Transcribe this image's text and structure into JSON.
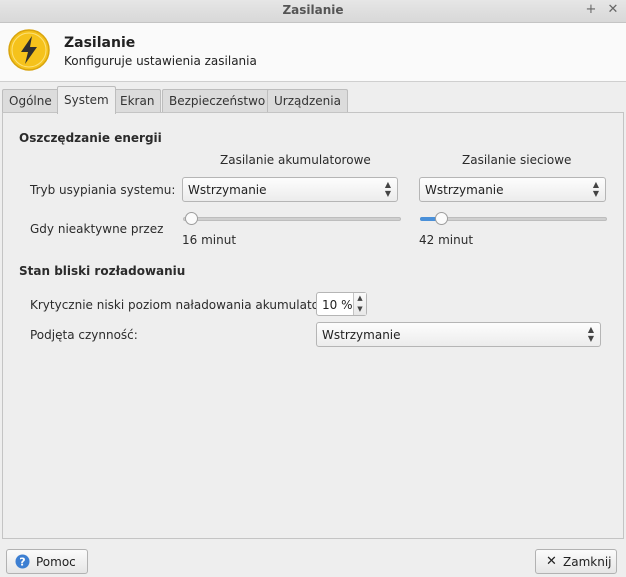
{
  "window": {
    "title": "Zasilanie"
  },
  "header": {
    "title": "Zasilanie",
    "subtitle": "Konfiguruje ustawienia zasilania"
  },
  "tabs": [
    {
      "label": "Ogólne"
    },
    {
      "label": "System"
    },
    {
      "label": "Ekran"
    },
    {
      "label": "Bezpieczeństwo"
    },
    {
      "label": "Urządzenia"
    }
  ],
  "energy": {
    "section_title": "Oszczędzanie energii",
    "battery_header": "Zasilanie akumulatorowe",
    "ac_header": "Zasilanie sieciowe",
    "sleep_label": "Tryb usypiania systemu:",
    "sleep_battery_value": "Wstrzymanie",
    "sleep_ac_value": "Wstrzymanie",
    "inactive_label": "Gdy nieaktywne przez",
    "battery_inactive_text": "16 minut",
    "ac_inactive_text": "42 minut"
  },
  "critical": {
    "section_title": "Stan bliski rozładowaniu",
    "level_label": "Krytycznie niski poziom naładowania akumulatora:",
    "level_value": "10 %",
    "action_label": "Podjęta czynność:",
    "action_value": "Wstrzymanie"
  },
  "footer": {
    "help_label": "Pomoc",
    "close_label": "Zamknij"
  },
  "colors": {
    "accent": "#4a90d9",
    "icon_yellow": "#f5c21b"
  }
}
